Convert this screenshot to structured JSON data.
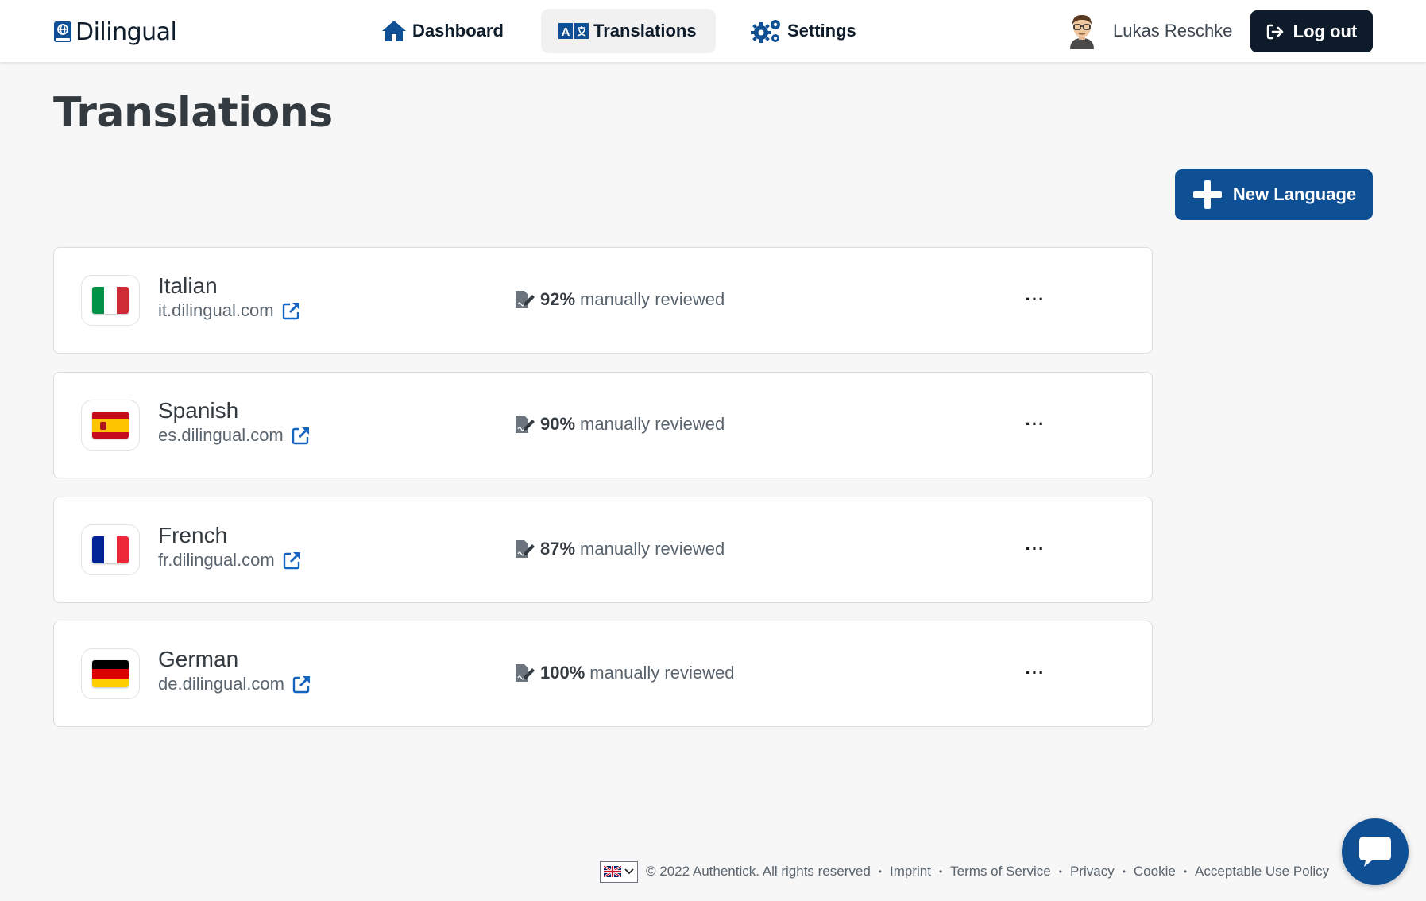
{
  "brand": {
    "name": "Dilingual"
  },
  "nav": {
    "items": [
      {
        "label": "Dashboard",
        "icon": "home-icon"
      },
      {
        "label": "Translations",
        "icon": "translate-icon",
        "active": true
      },
      {
        "label": "Settings",
        "icon": "gears-icon"
      }
    ]
  },
  "user": {
    "name": "Lukas Reschke",
    "logout_label": "Log out"
  },
  "page": {
    "title": "Translations",
    "new_language_label": "New Language"
  },
  "languages": [
    {
      "name": "Italian",
      "domain": "it.dilingual.com",
      "percent": "92%",
      "review_text": "manually reviewed",
      "flag": "italy"
    },
    {
      "name": "Spanish",
      "domain": "es.dilingual.com",
      "percent": "90%",
      "review_text": "manually reviewed",
      "flag": "spain"
    },
    {
      "name": "French",
      "domain": "fr.dilingual.com",
      "percent": "87%",
      "review_text": "manually reviewed",
      "flag": "france"
    },
    {
      "name": "German",
      "domain": "de.dilingual.com",
      "percent": "100%",
      "review_text": "manually reviewed",
      "flag": "germany"
    }
  ],
  "more_label": "···",
  "footer": {
    "copyright": "© 2022 Authentick. All rights reserved",
    "links": [
      "Imprint",
      "Terms of Service",
      "Privacy",
      "Cookie",
      "Acceptable Use Policy"
    ],
    "separator": "•"
  },
  "colors": {
    "primary": "#0f4f94",
    "dark": "#0d1b2a",
    "background": "#f7f7f7"
  }
}
